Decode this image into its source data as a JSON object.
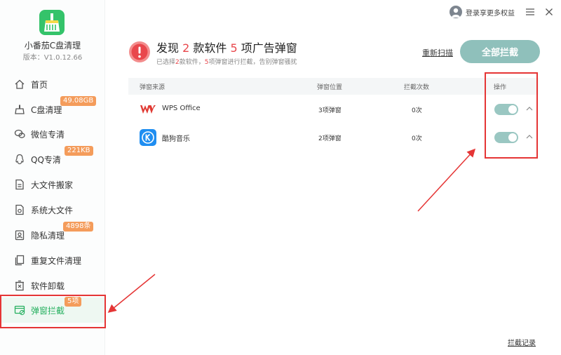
{
  "app": {
    "name": "小番茄C盘清理",
    "version": "版本：V1.0.12.66"
  },
  "topbar": {
    "login_text": "登录享更多权益"
  },
  "sidebar": {
    "items": [
      {
        "label": "首页",
        "icon": "home-icon",
        "badge": ""
      },
      {
        "label": "C盘清理",
        "icon": "broom-icon",
        "badge": "49.08GB"
      },
      {
        "label": "微信专清",
        "icon": "wechat-icon",
        "badge": ""
      },
      {
        "label": "QQ专清",
        "icon": "qq-icon",
        "badge": "221KB"
      },
      {
        "label": "大文件搬家",
        "icon": "file-move-icon",
        "badge": ""
      },
      {
        "label": "系统大文件",
        "icon": "system-file-icon",
        "badge": ""
      },
      {
        "label": "隐私清理",
        "icon": "privacy-icon",
        "badge": "4898条"
      },
      {
        "label": "重复文件清理",
        "icon": "duplicate-file-icon",
        "badge": ""
      },
      {
        "label": "软件卸载",
        "icon": "uninstall-icon",
        "badge": ""
      },
      {
        "label": "弹窗拦截",
        "icon": "popup-block-icon",
        "badge": "5项"
      }
    ],
    "active_index": 9
  },
  "header": {
    "title_pre": "发现",
    "title_num1": "2",
    "title_mid": "款软件",
    "title_num2": "5",
    "title_post": "项广告弹窗",
    "sub_pre": "已选择",
    "sub_num1": "2",
    "sub_mid": "款软件，",
    "sub_num2": "5",
    "sub_post": "项弹窗进行拦截，告别弹窗骚扰",
    "rescan_label": "重新扫描",
    "block_all_label": "全部拦截"
  },
  "table": {
    "columns": [
      "弹窗来源",
      "弹窗位置",
      "拦截次数",
      "操作"
    ],
    "rows": [
      {
        "name": "WPS Office",
        "position": "3项弹窗",
        "count": "0次",
        "enabled": true,
        "icon": "wps-icon"
      },
      {
        "name": "酷狗音乐",
        "position": "2项弹窗",
        "count": "0次",
        "enabled": true,
        "icon": "kugou-icon"
      }
    ]
  },
  "footer": {
    "records_label": "拦截记录"
  },
  "colors": {
    "accent": "#27b060",
    "highlight": "#e8474c",
    "button": "#8fc0bb",
    "badge": "#f49c5b",
    "annotation": "#e53535"
  }
}
